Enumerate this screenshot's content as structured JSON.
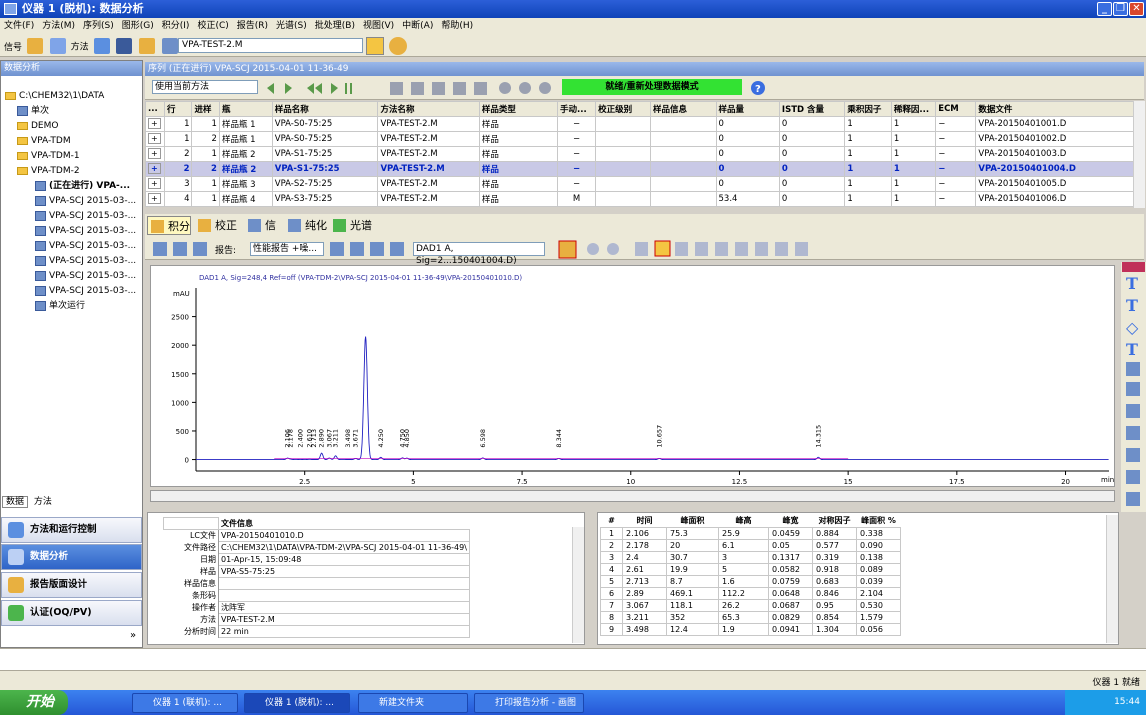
{
  "window": {
    "title": "仪器 1 (脱机): 数据分析"
  },
  "menu": [
    "文件(F)",
    "方法(M)",
    "序列(S)",
    "图形(G)",
    "积分(I)",
    "校正(C)",
    "报告(R)",
    "光谱(S)",
    "批处理(B)",
    "视图(V)",
    "中断(A)",
    "帮助(H)"
  ],
  "toolbar": {
    "signal_label": "信号",
    "method_label": "方法",
    "method_value": "VPA-TEST-2.M"
  },
  "left_panel": {
    "title": "数据分析",
    "tree": [
      "C:\\CHEM32\\1\\DATA",
      "单次",
      "DEMO",
      "VPA-TDM",
      "VPA-TDM-1",
      "VPA-TDM-2",
      "(正在进行) VPA-...",
      "VPA-SCJ 2015-03-...",
      "VPA-SCJ 2015-03-...",
      "VPA-SCJ 2015-03-...",
      "VPA-SCJ 2015-03-...",
      "VPA-SCJ 2015-03-...",
      "VPA-SCJ 2015-03-...",
      "VPA-SCJ 2015-03-...",
      "单次运行"
    ],
    "tabs": [
      "数据",
      "方法"
    ],
    "nav": [
      "方法和运行控制",
      "数据分析",
      "报告版面设计",
      "认证(OQ/PV)"
    ]
  },
  "sequence": {
    "header": "序列 (正在进行) VPA-SCJ 2015-04-01 11-36-49",
    "use_method": "使用当前方法",
    "status": "就绪/重新处理数据模式",
    "columns": [
      "...",
      "行",
      "进样",
      "瓶",
      "样品名称",
      "方法名称",
      "样品类型",
      "手动...",
      "校正级别",
      "样品信息",
      "样品量",
      "ISTD 含量",
      "乘积因子",
      "稀释因...",
      "ECM",
      "数据文件"
    ],
    "rows": [
      [
        "",
        "1",
        "1",
        "样品瓶 1",
        "VPA-S0-75:25",
        "VPA-TEST-2.M",
        "样品",
        "−",
        "",
        "",
        "0",
        "0",
        "1",
        "1",
        "−",
        "VPA-20150401001.D"
      ],
      [
        "",
        "1",
        "2",
        "样品瓶 1",
        "VPA-S0-75:25",
        "VPA-TEST-2.M",
        "样品",
        "−",
        "",
        "",
        "0",
        "0",
        "1",
        "1",
        "−",
        "VPA-20150401002.D"
      ],
      [
        "",
        "2",
        "1",
        "样品瓶 2",
        "VPA-S1-75:25",
        "VPA-TEST-2.M",
        "样品",
        "−",
        "",
        "",
        "0",
        "0",
        "1",
        "1",
        "−",
        "VPA-20150401003.D"
      ],
      [
        "",
        "2",
        "2",
        "样品瓶 2",
        "VPA-S1-75:25",
        "VPA-TEST-2.M",
        "样品",
        "−",
        "",
        "",
        "0",
        "0",
        "1",
        "1",
        "−",
        "VPA-20150401004.D"
      ],
      [
        "",
        "3",
        "1",
        "样品瓶 3",
        "VPA-S2-75:25",
        "VPA-TEST-2.M",
        "样品",
        "−",
        "",
        "",
        "0",
        "0",
        "1",
        "1",
        "−",
        "VPA-20150401005.D"
      ],
      [
        "",
        "4",
        "1",
        "样品瓶 4",
        "VPA-S3-75:25",
        "VPA-TEST-2.M",
        "样品",
        "M",
        "",
        "",
        "53.4",
        "0",
        "1",
        "1",
        "−",
        "VPA-20150401006.D"
      ]
    ]
  },
  "tabs": [
    "积分",
    "校正",
    "信号",
    "纯化",
    "光谱"
  ],
  "chart_toolbar": {
    "report_label": "报告:",
    "report_value": "性能报告 +噪...",
    "signal_select": "DAD1 A, Sig=2...150401004.D)"
  },
  "chart_data": {
    "type": "line",
    "title": "DAD1 A, Sig=248,4 Ref=off (VPA-TDM-2\\VPA-SCJ 2015-04-01 11-36-49\\VPA-20150401010.D)",
    "ylabel": "mAU",
    "xlabel": "min",
    "xlim": [
      0,
      21
    ],
    "ylim": [
      -200,
      3000
    ],
    "yticks": [
      0,
      500,
      1000,
      1500,
      2000,
      2500
    ],
    "xticks": [
      2.5,
      5,
      7.5,
      10,
      12.5,
      15,
      17.5,
      20
    ],
    "peaks": [
      {
        "t": 2.106,
        "h": 25.9
      },
      {
        "t": 2.178,
        "h": 6.1
      },
      {
        "t": 2.4,
        "h": 3
      },
      {
        "t": 2.61,
        "h": 5
      },
      {
        "t": 2.713,
        "h": 1.6
      },
      {
        "t": 2.89,
        "h": 112.2
      },
      {
        "t": 3.067,
        "h": 26.2
      },
      {
        "t": 3.211,
        "h": 65.3
      },
      {
        "t": 3.498,
        "h": 1.9
      },
      {
        "t": 3.671,
        "h": 20
      },
      {
        "t": 3.9,
        "h": 2150
      },
      {
        "t": 4.25,
        "h": 40
      },
      {
        "t": 4.75,
        "h": 30
      },
      {
        "t": 4.85,
        "h": 25
      },
      {
        "t": 6.598,
        "h": 30
      },
      {
        "t": 8.344,
        "h": 20
      },
      {
        "t": 10.657,
        "h": 20
      },
      {
        "t": 14.315,
        "h": 40
      }
    ],
    "peak_labels": [
      {
        "t": 2.106,
        "label": "2.106"
      },
      {
        "t": 2.178,
        "label": "2.178"
      },
      {
        "t": 2.4,
        "label": "2.400"
      },
      {
        "t": 2.61,
        "label": "2.610"
      },
      {
        "t": 2.713,
        "label": "2.713"
      },
      {
        "t": 2.89,
        "label": "2.890"
      },
      {
        "t": 3.067,
        "label": "3.067"
      },
      {
        "t": 3.211,
        "label": "3.211"
      },
      {
        "t": 3.498,
        "label": "3.498"
      },
      {
        "t": 3.671,
        "label": "3.671"
      },
      {
        "t": 4.25,
        "label": "4.250"
      },
      {
        "t": 4.75,
        "label": "4.750"
      },
      {
        "t": 4.85,
        "label": "4.850"
      },
      {
        "t": 6.598,
        "label": "6.598"
      },
      {
        "t": 8.344,
        "label": "8.344"
      },
      {
        "t": 10.657,
        "label": "10.657"
      },
      {
        "t": 14.315,
        "label": "14.315"
      }
    ]
  },
  "file_info": {
    "title": "文件信息",
    "rows": [
      [
        "LC文件",
        "VPA-20150401010.D"
      ],
      [
        "文件路径",
        "C:\\CHEM32\\1\\DATA\\VPA-TDM-2\\VPA-SCJ 2015-04-01 11-36-49\\"
      ],
      [
        "日期",
        "01-Apr-15, 15:09:48"
      ],
      [
        "样品",
        "VPA-S5-75:25"
      ],
      [
        "样品信息",
        ""
      ],
      [
        "条形码",
        ""
      ],
      [
        "操作者",
        "沈阵军"
      ],
      [
        "方法",
        "VPA-TEST-2.M"
      ],
      [
        "分析时间",
        "22 min"
      ]
    ]
  },
  "peak_table": {
    "columns": [
      "#",
      "时间",
      "峰面积",
      "峰高",
      "峰宽",
      "对称因子",
      "峰面积 %"
    ],
    "rows": [
      [
        "1",
        "2.106",
        "75.3",
        "25.9",
        "0.0459",
        "0.884",
        "0.338"
      ],
      [
        "2",
        "2.178",
        "20",
        "6.1",
        "0.05",
        "0.577",
        "0.090"
      ],
      [
        "3",
        "2.4",
        "30.7",
        "3",
        "0.1317",
        "0.319",
        "0.138"
      ],
      [
        "4",
        "2.61",
        "19.9",
        "5",
        "0.0582",
        "0.918",
        "0.089"
      ],
      [
        "5",
        "2.713",
        "8.7",
        "1.6",
        "0.0759",
        "0.683",
        "0.039"
      ],
      [
        "6",
        "2.89",
        "469.1",
        "112.2",
        "0.0648",
        "0.846",
        "2.104"
      ],
      [
        "7",
        "3.067",
        "118.1",
        "26.2",
        "0.0687",
        "0.95",
        "0.530"
      ],
      [
        "8",
        "3.211",
        "352",
        "65.3",
        "0.0829",
        "0.854",
        "1.579"
      ],
      [
        "9",
        "3.498",
        "12.4",
        "1.9",
        "0.0941",
        "1.304",
        "0.056"
      ]
    ]
  },
  "bottom_status": "仪器 1  就绪",
  "taskbar": {
    "start": "开始",
    "tasks": [
      "仪器 1 (联机): ...",
      "仪器 1 (脱机): ...",
      "新建文件夹",
      "打印报告分析 - 画图"
    ],
    "clock": "15:44"
  }
}
